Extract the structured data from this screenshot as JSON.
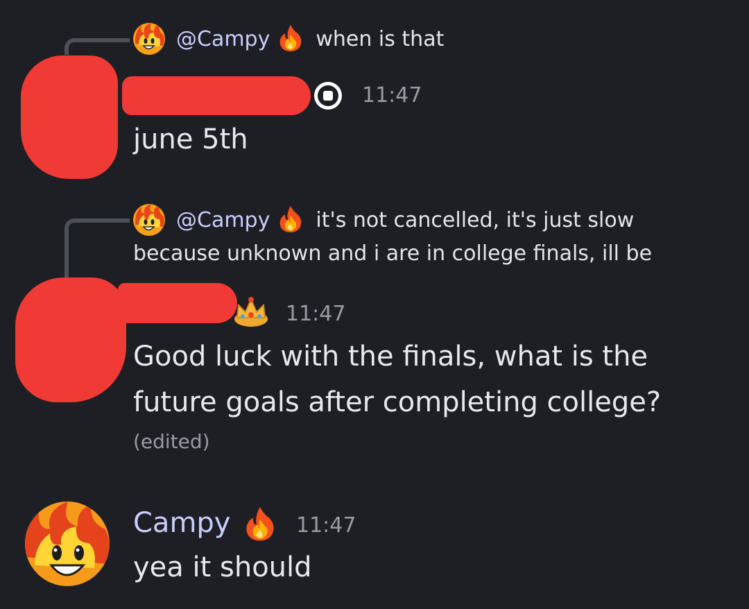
{
  "colors": {
    "background": "#1e1f25",
    "username": "#c9cdfb",
    "text": "#e8e9ec",
    "muted": "#9a9ca4",
    "redaction": "#f03a36",
    "reply_line": "#4e5058"
  },
  "messages": [
    {
      "reply": {
        "mention": "@Campy",
        "text": "when is that",
        "avatar_icon": "fire-face-icon",
        "badge_icon": "fire-emoji-icon"
      },
      "author_badge_icon": "roblox-logo-icon",
      "timestamp": "11:47",
      "content": "june 5th"
    },
    {
      "reply": {
        "mention": "@Campy",
        "text": "it's not cancelled, it's just slow",
        "text_line2": "because unknown and i are in college finals, ill be",
        "avatar_icon": "fire-face-icon",
        "badge_icon": "fire-emoji-icon"
      },
      "author_badge_icon": "crown-emoji-icon",
      "timestamp": "11:47",
      "content_line1": "Good luck with the finals, what is the",
      "content_line2": "future goals after completing college?",
      "edited": "(edited)"
    },
    {
      "author": "Campy",
      "author_badge_icon": "fire-emoji-icon",
      "avatar_icon": "fire-face-icon",
      "timestamp": "11:47",
      "content": "yea it should"
    }
  ]
}
